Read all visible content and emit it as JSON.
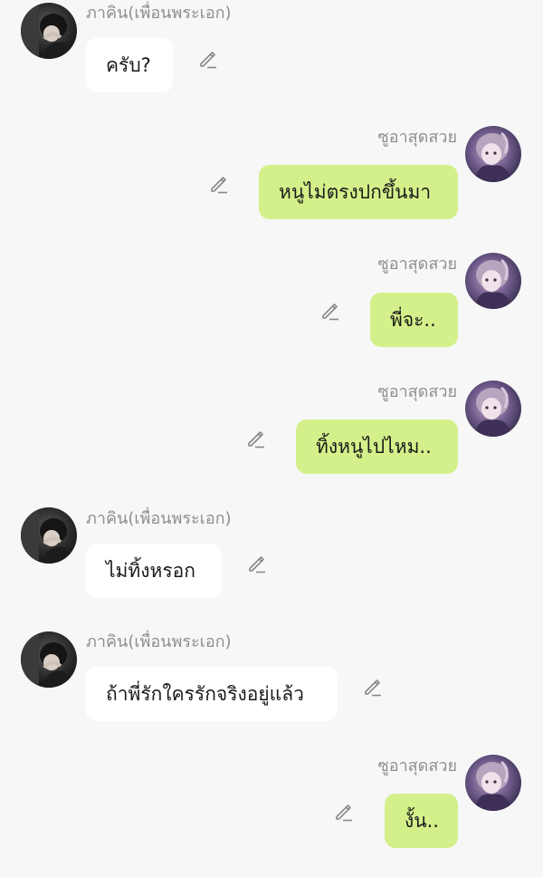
{
  "participants": {
    "left_name": "ภาคิน(เพื่อนพระเอก)",
    "right_name": "ซูอาสุดสวย"
  },
  "messages": [
    {
      "side": "left",
      "sender": "ภาคิน(เพื่อนพระเอก)",
      "text": "ครับ?"
    },
    {
      "side": "right",
      "sender": "ซูอาสุดสวย",
      "text": "หนูไม่ตรงปกขึ้นมา"
    },
    {
      "side": "right",
      "sender": "ซูอาสุดสวย",
      "text": "พี่จะ.."
    },
    {
      "side": "right",
      "sender": "ซูอาสุดสวย",
      "text": "ทิ้งหนูไปไหม.."
    },
    {
      "side": "left",
      "sender": "ภาคิน(เพื่อนพระเอก)",
      "text": "ไม่ทิ้งหรอก"
    },
    {
      "side": "left",
      "sender": "ภาคิน(เพื่อนพระเอก)",
      "text": "ถ้าพี่รักใครรักจริงอยู่แล้ว"
    },
    {
      "side": "right",
      "sender": "ซูอาสุดสวย",
      "text": "งั้น.."
    }
  ],
  "icons": {
    "edit": "pencil-icon",
    "left_avatar": "avatar-boy-dark",
    "right_avatar": "avatar-girl-purple"
  },
  "colors": {
    "background": "#f7f7f7",
    "left_bubble": "#ffffff",
    "right_bubble": "#d4f08a",
    "name_text": "#8e8e8e",
    "edit_icon": "#888888"
  }
}
